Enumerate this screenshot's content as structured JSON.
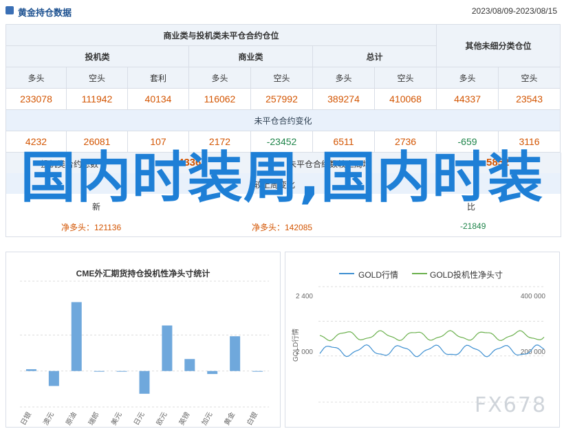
{
  "header": {
    "title": "黄金持仓数据",
    "date_range": "2023/08/09-2023/08/15"
  },
  "table": {
    "group_main": "商业类与投机类未平仓合约仓位",
    "group_other": "其他未细分类仓位",
    "sub_spec": "投机类",
    "sub_comm": "商业类",
    "sub_total": "总计",
    "col_long": "多头",
    "col_short": "空头",
    "col_arb": "套利",
    "values": [
      "233078",
      "111942",
      "40134",
      "116062",
      "257992",
      "389274",
      "410068",
      "44337",
      "23543"
    ],
    "oi_change_title": "未平仓合约变化",
    "changes": [
      "4232",
      "26081",
      "107",
      "2172",
      "-23452",
      "6511",
      "2736",
      "-659",
      "3116"
    ]
  },
  "partial": {
    "spec_net_label": "投机类合约总数",
    "spec_net_value": "4336",
    "comm_week_label": "未平仓合约数较上周增",
    "comm_week_value": "5852",
    "change_label": "较上周变化",
    "new_label": "新",
    "comp_label": "比",
    "net_long_label": "净多头：121136",
    "net_short_label": "净多头：142085",
    "net_right_value": "-21849"
  },
  "overlay": {
    "text": "国内时装周,国内时装"
  },
  "chart_left": {
    "title": "CME外汇期货持仓投机性净头寸统计"
  },
  "chart_data": [
    {
      "type": "bar",
      "categories": [
        "日银",
        "澳元",
        "原油",
        "瑞郎",
        "美元",
        "日元",
        "欧元",
        "英镑",
        "加元",
        "黄金",
        "白银"
      ],
      "values": [
        0.3,
        -2.5,
        11.5,
        -0.1,
        -0.1,
        -3.8,
        7.6,
        2.0,
        -0.5,
        5.8,
        0
      ],
      "ylim": [
        -6,
        15
      ]
    },
    {
      "type": "line",
      "legend": [
        "GOLD行情",
        "GOLD投机性净头寸"
      ],
      "y_left_label": "GOLD行情",
      "y_left_ticks": [
        "2 400",
        "2 000"
      ],
      "y_right_ticks": [
        "400 000",
        "200 000"
      ]
    }
  ],
  "watermark": {
    "text": "FX678"
  },
  "colors": {
    "title": "#1a4f8f",
    "positive": "#d35400",
    "negative": "#1e8449",
    "bar": "#6fa8dc",
    "overlay": "#1e7fd6",
    "line_gold": "#3d8fd1",
    "line_net": "#6ab04c"
  }
}
